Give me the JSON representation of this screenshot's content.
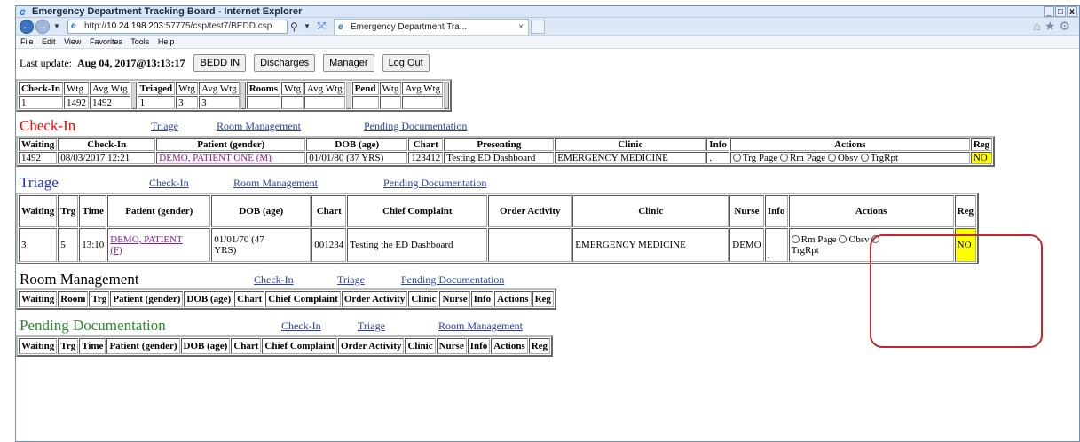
{
  "window": {
    "title": "Emergency Department Tracking Board - Internet Explorer",
    "controls": [
      "_",
      "□",
      "x"
    ]
  },
  "browser": {
    "url_prefix": "http://",
    "url_host": "10.24.198.203",
    "url_path": ":57775/csp/test7/BEDD.csp",
    "tab_title": "Emergency Department Tra...",
    "tab_close": "×"
  },
  "menu": [
    "File",
    "Edit",
    "View",
    "Favorites",
    "Tools",
    "Help"
  ],
  "topbar": {
    "last_update_label": "Last update:",
    "last_update_value": "Aug 04, 2017@13:13:17",
    "buttons": [
      "BEDD IN",
      "Discharges",
      "Manager",
      "Log Out"
    ]
  },
  "summary": {
    "groups": [
      {
        "headers": [
          "Check-In",
          "Wtg",
          "Avg Wtg"
        ],
        "values": [
          "1",
          "1492",
          "1492"
        ]
      },
      {
        "headers": [
          "Triaged",
          "Wtg",
          "Avg Wtg"
        ],
        "values": [
          "1",
          "3",
          "3"
        ]
      },
      {
        "headers": [
          "Rooms",
          "Wtg",
          "Avg Wtg"
        ],
        "values": [
          "",
          "",
          ""
        ]
      },
      {
        "headers": [
          "Pend",
          "Wtg",
          "Avg Wtg"
        ],
        "values": [
          "",
          "",
          ""
        ]
      }
    ]
  },
  "checkin": {
    "title": "Check-In",
    "title_color": "#ff0000",
    "links": [
      "Triage",
      "Room Management",
      "Pending Documentation"
    ],
    "headers": [
      "Waiting",
      "Check-In",
      "Patient (gender)",
      "DOB (age)",
      "Chart",
      "Presenting",
      "Clinic",
      "Info",
      "Actions",
      "Reg"
    ],
    "row": {
      "waiting": "1492",
      "checkin": "08/03/2017 12:21",
      "patient": "DEMO, PATIENT ONE (M)",
      "dob": "01/01/80 (37 YRS)",
      "chart": "123412",
      "presenting": "Testing ED Dashboard",
      "clinic": "EMERGENCY MEDICINE",
      "info": ".",
      "actions": [
        "Trg Page",
        "Rm Page",
        "Obsv",
        "TrgRpt"
      ],
      "reg": "NO"
    }
  },
  "triage": {
    "title": "Triage",
    "title_color": "#1a33cc",
    "links": [
      "Check-In",
      "Room Management",
      "Pending Documentation"
    ],
    "headers": [
      "Waiting",
      "Trg",
      "Time",
      "Patient (gender)",
      "DOB (age)",
      "Chart",
      "Chief Complaint",
      "Order Activity",
      "Clinic",
      "Nurse",
      "Info",
      "Actions",
      "Reg"
    ],
    "row": {
      "waiting": "3",
      "trg": "5",
      "time": "13:10",
      "patient_line1": "DEMO, PATIENT",
      "patient_line2": "(F)",
      "dob_line1": "01/01/70 (47",
      "dob_line2": "YRS)",
      "chart": "001234",
      "complaint": "Testing the ED Dashboard",
      "order": "",
      "clinic": "EMERGENCY MEDICINE",
      "nurse": "DEMO",
      "info": ".",
      "actions": [
        "Rm Page",
        "Obsv",
        "TrgRpt"
      ],
      "reg": "NO"
    }
  },
  "room": {
    "title": "Room Management",
    "title_color": "#000000",
    "links": [
      "Check-In",
      "Triage",
      "Pending Documentation"
    ],
    "headers": [
      "Waiting",
      "Room",
      "Trg",
      "Patient (gender)",
      "DOB (age)",
      "Chart",
      "Chief Complaint",
      "Order Activity",
      "Clinic",
      "Nurse",
      "Info",
      "Actions",
      "Reg"
    ]
  },
  "pending": {
    "title": "Pending Documentation",
    "title_color": "#2b8a2b",
    "links": [
      "Check-In",
      "Triage",
      "Room Management"
    ],
    "headers": [
      "Waiting",
      "Trg",
      "Time",
      "Patient (gender)",
      "DOB (age)",
      "Chart",
      "Chief Complaint",
      "Order Activity",
      "Clinic",
      "Nurse",
      "Info",
      "Actions",
      "Reg"
    ]
  }
}
